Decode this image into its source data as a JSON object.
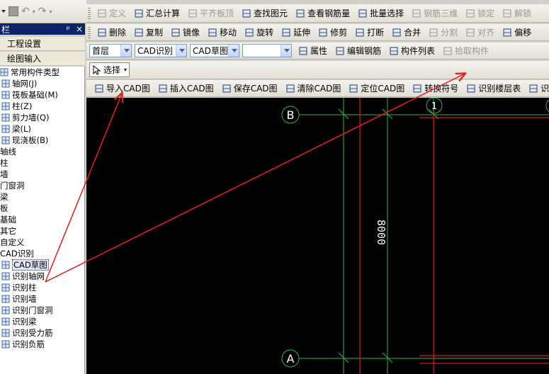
{
  "panel": {
    "title": "栏",
    "pin": "ᵖ",
    "close": "×",
    "nav": [
      "工程设置",
      "绘图输入"
    ]
  },
  "tree": [
    {
      "label": "常用构件类型",
      "indent": 0,
      "icon": "folder-icon"
    },
    {
      "label": "轴网(J)",
      "indent": 1,
      "icon": "grid-icon"
    },
    {
      "label": "筏板基础(M)",
      "indent": 1,
      "icon": "raft-icon"
    },
    {
      "label": "柱(Z)",
      "indent": 1,
      "icon": "column-icon"
    },
    {
      "label": "剪力墙(Q)",
      "indent": 1,
      "icon": "wall-icon"
    },
    {
      "label": "梁(L)",
      "indent": 1,
      "icon": "beam-icon"
    },
    {
      "label": "现浇板(B)",
      "indent": 1,
      "icon": "slab-icon"
    },
    {
      "label": "轴线",
      "indent": 0,
      "icon": ""
    },
    {
      "label": "柱",
      "indent": 0,
      "icon": ""
    },
    {
      "label": "墙",
      "indent": 0,
      "icon": ""
    },
    {
      "label": "门窗洞",
      "indent": 0,
      "icon": ""
    },
    {
      "label": "梁",
      "indent": 0,
      "icon": ""
    },
    {
      "label": "板",
      "indent": 0,
      "icon": ""
    },
    {
      "label": "基础",
      "indent": 0,
      "icon": ""
    },
    {
      "label": "其它",
      "indent": 0,
      "icon": ""
    },
    {
      "label": "自定义",
      "indent": 0,
      "icon": ""
    },
    {
      "label": "CAD识别",
      "indent": 0,
      "icon": ""
    },
    {
      "label": "CAD草图",
      "indent": 1,
      "icon": "cad-sketch-icon",
      "selected": true
    },
    {
      "label": "识别轴网",
      "indent": 1,
      "icon": "recognize-icon"
    },
    {
      "label": "识别柱",
      "indent": 1,
      "icon": "recognize-icon"
    },
    {
      "label": "识别墙",
      "indent": 1,
      "icon": "recognize-icon"
    },
    {
      "label": "识别门窗洞",
      "indent": 1,
      "icon": "recognize-icon"
    },
    {
      "label": "识别梁",
      "indent": 1,
      "icon": "recognize-icon"
    },
    {
      "label": "识别受力筋",
      "indent": 1,
      "icon": "recognize-icon"
    },
    {
      "label": "识别负筋",
      "indent": 1,
      "icon": "recognize-icon"
    }
  ],
  "toolbar1": [
    {
      "label": "定义",
      "icon": "define-icon",
      "disabled": true
    },
    {
      "label": "汇总计算",
      "icon": "sigma-icon"
    },
    {
      "label": "平齐板顶",
      "icon": "align-top-icon",
      "disabled": true
    },
    {
      "label": "查找图元",
      "icon": "find-icon"
    },
    {
      "label": "查看钢筋量",
      "icon": "view-rebar-icon"
    },
    {
      "label": "批量选择",
      "icon": "batch-select-icon"
    },
    {
      "label": "钢筋三维",
      "icon": "rebar-3d-icon",
      "disabled": true
    },
    {
      "label": "锁定",
      "icon": "lock-icon",
      "disabled": true
    },
    {
      "label": "解锁",
      "icon": "unlock-icon",
      "disabled": true
    }
  ],
  "toolbar2": [
    {
      "label": "删除",
      "icon": "delete-icon"
    },
    {
      "label": "复制",
      "icon": "copy-icon"
    },
    {
      "label": "镜像",
      "icon": "mirror-icon"
    },
    {
      "label": "移动",
      "icon": "move-icon"
    },
    {
      "label": "旋转",
      "icon": "rotate-icon"
    },
    {
      "label": "延伸",
      "icon": "extend-icon"
    },
    {
      "label": "修剪",
      "icon": "trim-icon"
    },
    {
      "label": "打断",
      "icon": "break-icon"
    },
    {
      "label": "合并",
      "icon": "merge-icon"
    },
    {
      "label": "分割",
      "icon": "split-icon",
      "disabled": true
    },
    {
      "label": "对齐",
      "icon": "align-icon",
      "disabled": true
    },
    {
      "label": "偏移",
      "icon": "offset-icon"
    }
  ],
  "toolbar3": {
    "floor": "首层",
    "category": "CAD识别",
    "type": "CAD草图",
    "empty": "",
    "buttons": [
      {
        "label": "属性",
        "icon": "properties-icon"
      },
      {
        "label": "编辑钢筋",
        "icon": "edit-rebar-icon"
      },
      {
        "label": "构件列表",
        "icon": "component-list-icon"
      },
      {
        "label": "拾取构件",
        "icon": "pick-component-icon",
        "disabled": true
      }
    ]
  },
  "toolbar4": {
    "select_label": "选择"
  },
  "toolbar5": [
    {
      "label": "导入CAD图",
      "icon": "import-cad-icon"
    },
    {
      "label": "插入CAD图",
      "icon": "insert-cad-icon"
    },
    {
      "label": "保存CAD图",
      "icon": "save-cad-icon"
    },
    {
      "label": "清除CAD图",
      "icon": "clear-cad-icon"
    },
    {
      "label": "定位CAD图",
      "icon": "locate-cad-icon"
    },
    {
      "label": "转换符号",
      "icon": "convert-symbol-icon"
    },
    {
      "label": "识别楼层表",
      "icon": "recognize-floor-table-icon"
    },
    {
      "label": "识别柱表",
      "icon": "recognize-column-table-icon"
    }
  ],
  "canvas": {
    "axis_b": "B",
    "axis_a": "A",
    "axis_1": "1",
    "dimension": "8000",
    "colors": {
      "background": "#000000",
      "green": "#2fb34a",
      "red": "#ff2020",
      "white": "#ffffff"
    }
  },
  "annotation_color": "#e0201c"
}
